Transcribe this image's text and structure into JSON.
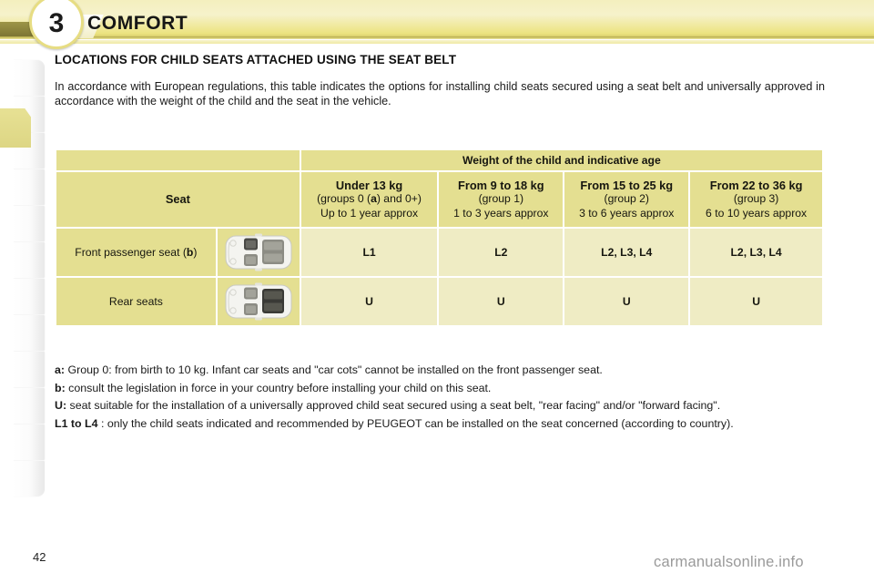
{
  "header": {
    "chapter_number": "3",
    "title": "COMFORT"
  },
  "section": {
    "title": "LOCATIONS FOR CHILD SEATS ATTACHED USING THE SEAT BELT",
    "intro": "In accordance with European regulations, this table indicates the options for installing child seats secured using a seat belt and universally approved in accordance with the weight of the child and the seat in the vehicle."
  },
  "table": {
    "super_header": "Weight of the child and indicative age",
    "seat_header": "Seat",
    "columns": [
      {
        "weight": "Under 13 kg",
        "group": "(groups 0 (a) and 0+)",
        "age": "Up to 1 year approx"
      },
      {
        "weight": "From 9 to 18 kg",
        "group": "(group 1)",
        "age": "1 to 3 years approx"
      },
      {
        "weight": "From 15 to 25 kg",
        "group": "(group 2)",
        "age": "3 to 6 years approx"
      },
      {
        "weight": "From 22 to 36 kg",
        "group": "(group 3)",
        "age": "6 to 10 years approx"
      }
    ],
    "rows": [
      {
        "seat_label": "Front passenger seat (b)",
        "seat_label_pre": "Front passenger seat (",
        "seat_label_bold": "b",
        "seat_label_post": ")",
        "icon": "car-top-view-front-passenger-icon",
        "values": [
          "L1",
          "L2",
          "L2, L3, L4",
          "L2, L3, L4"
        ]
      },
      {
        "seat_label": "Rear seats",
        "seat_label_pre": "Rear seats",
        "seat_label_bold": "",
        "seat_label_post": "",
        "icon": "car-top-view-rear-seats-icon",
        "values": [
          "U",
          "U",
          "U",
          "U"
        ]
      }
    ]
  },
  "notes": [
    {
      "label": "a:",
      "text": "Group 0: from birth to 10 kg. Infant car seats and \"car cots\" cannot be installed on the front passenger seat."
    },
    {
      "label": "b:",
      "text": "consult the legislation in force in your country before installing your child on this seat."
    },
    {
      "label": "U:",
      "text": "seat suitable for the installation of a universally approved child seat secured using a seat belt, \"rear facing\" and/or \"forward facing\"."
    },
    {
      "label": "L1 to L4",
      "text": ": only the child seats indicated and recommended by PEUGEOT can be installed on the seat concerned (according to country)."
    }
  ],
  "footer": {
    "page_number": "42",
    "watermark": "carmanualsonline.info"
  },
  "colors": {
    "band_top": "#f4efbe",
    "band_bottom": "#ece37f",
    "table_header": "#e4df91",
    "table_body": "#efecc4",
    "tab_active": "#e7e194",
    "text": "#1a1a1a"
  }
}
